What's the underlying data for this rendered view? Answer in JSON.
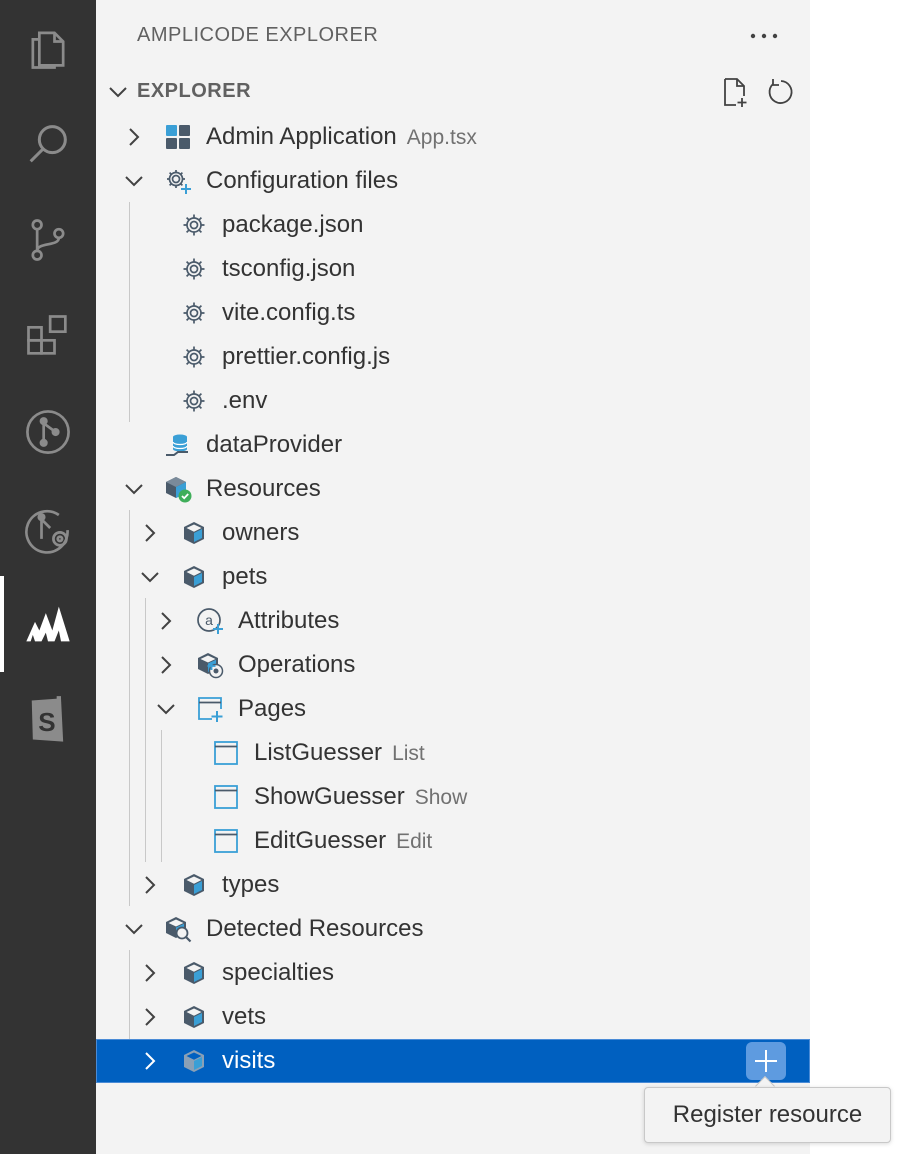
{
  "activity_bar": {
    "items": [
      {
        "icon": "files-icon"
      },
      {
        "icon": "search-icon"
      },
      {
        "icon": "source-control-icon"
      },
      {
        "icon": "extensions-icon"
      },
      {
        "icon": "git-graph-icon"
      },
      {
        "icon": "git-lens-icon"
      },
      {
        "icon": "amplicode-icon",
        "active": true
      },
      {
        "icon": "storybook-icon"
      }
    ]
  },
  "panel": {
    "title": "AMPLICODE EXPLORER",
    "more_label": "···"
  },
  "section": {
    "title": "EXPLORER"
  },
  "tree": [
    {
      "label": "Admin Application",
      "description": "App.tsx",
      "icon": "app-grid-icon",
      "expanded": false
    },
    {
      "label": "Configuration files",
      "description": "",
      "icon": "config-gear-icon",
      "expanded": true
    },
    {
      "label": "package.json",
      "description": "",
      "icon": "gear-icon"
    },
    {
      "label": "tsconfig.json",
      "description": "",
      "icon": "gear-icon"
    },
    {
      "label": "vite.config.ts",
      "description": "",
      "icon": "gear-icon"
    },
    {
      "label": "prettier.config.js",
      "description": "",
      "icon": "gear-icon"
    },
    {
      "label": ".env",
      "description": "",
      "icon": "gear-icon"
    },
    {
      "label": "dataProvider",
      "description": "",
      "icon": "database-icon"
    },
    {
      "label": "Resources",
      "description": "",
      "icon": "resources-check-icon",
      "expanded": true
    },
    {
      "label": "owners",
      "description": "",
      "icon": "cube-icon",
      "expanded": false
    },
    {
      "label": "pets",
      "description": "",
      "icon": "cube-icon",
      "expanded": true
    },
    {
      "label": "Attributes",
      "description": "",
      "icon": "attributes-icon",
      "expanded": false
    },
    {
      "label": "Operations",
      "description": "",
      "icon": "operations-icon",
      "expanded": false
    },
    {
      "label": "Pages",
      "description": "",
      "icon": "pages-icon",
      "expanded": true
    },
    {
      "label": "ListGuesser",
      "description": "List",
      "icon": "window-icon"
    },
    {
      "label": "ShowGuesser",
      "description": "Show",
      "icon": "window-icon"
    },
    {
      "label": "EditGuesser",
      "description": "Edit",
      "icon": "window-icon"
    },
    {
      "label": "types",
      "description": "",
      "icon": "cube-icon",
      "expanded": false
    },
    {
      "label": "Detected Resources",
      "description": "",
      "icon": "detected-resources-icon",
      "expanded": true
    },
    {
      "label": "specialties",
      "description": "",
      "icon": "cube-icon",
      "expanded": false
    },
    {
      "label": "vets",
      "description": "",
      "icon": "cube-icon",
      "expanded": false
    },
    {
      "label": "visits",
      "description": "",
      "icon": "cube-icon",
      "expanded": false,
      "selected": true
    }
  ],
  "tooltip": {
    "text": "Register resource"
  },
  "colors": {
    "activity_bar_bg": "#333333",
    "panel_bg": "#f3f3f3",
    "selection_bg": "#0060c0",
    "icon_blue": "#3a9fd6",
    "action_button_bg": "#5e9be0"
  }
}
